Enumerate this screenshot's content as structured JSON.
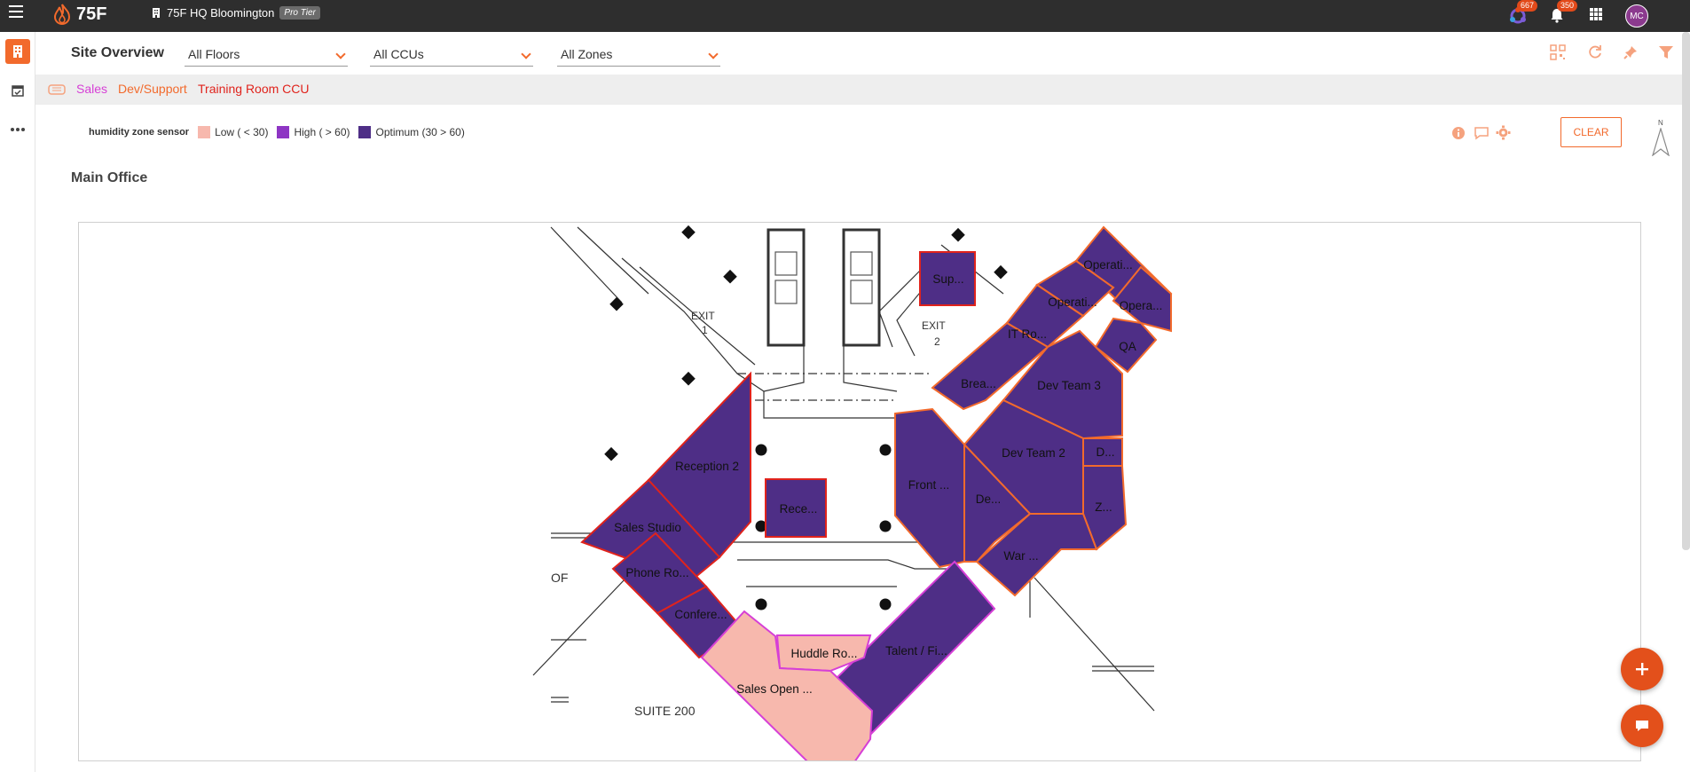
{
  "topbar": {
    "logo_text": "75F",
    "site_name": "75F HQ Bloomington",
    "tier": "Pro Tier",
    "alerts_badge": "667",
    "notifications_badge": "350",
    "avatar_initials": "MC"
  },
  "header": {
    "title": "Site Overview",
    "floors_select": "All Floors",
    "ccus_select": "All CCUs",
    "zones_select": "All Zones"
  },
  "ccu_bar": {
    "items": [
      {
        "label": "Sales",
        "color": "#d63fd6"
      },
      {
        "label": "Dev/Support",
        "color": "#f26a2c"
      },
      {
        "label": "Training Room CCU",
        "color": "#e0231c"
      }
    ]
  },
  "legend": {
    "label": "humidity zone sensor",
    "items": [
      {
        "label": "Low ( < 30)",
        "color": "#f7b8ad"
      },
      {
        "label": "High ( > 60)",
        "color": "#8e35c4"
      },
      {
        "label": "Optimum (30 > 60)",
        "color": "#4e2e86"
      }
    ]
  },
  "tools": {
    "clear_label": "CLEAR",
    "compass_label": "N"
  },
  "section": {
    "title": "Main Office"
  },
  "map": {
    "exit1": "EXIT",
    "exit1_num": "1",
    "exit2": "EXIT",
    "exit2_num": "2",
    "suite": "SUITE 200",
    "of_label": "OF",
    "zones": [
      "Operati...",
      "Operati...",
      "Opera...",
      "QA",
      "Sup...",
      "IT Ro...",
      "Brea...",
      "Dev Team 3",
      "Dev Team 2",
      "D...",
      "Reception 2",
      "Rece...",
      "Front ...",
      "De...",
      "Z...",
      "Sales Studio",
      "Phone Ro...",
      "War ...",
      "Confere...",
      "Huddle Ro...",
      "Talent / Fi...",
      "Sales Open ..."
    ]
  },
  "colors": {
    "accent": "#f26a2c",
    "optimum": "#4e2e86",
    "low": "#f7b8ad"
  }
}
